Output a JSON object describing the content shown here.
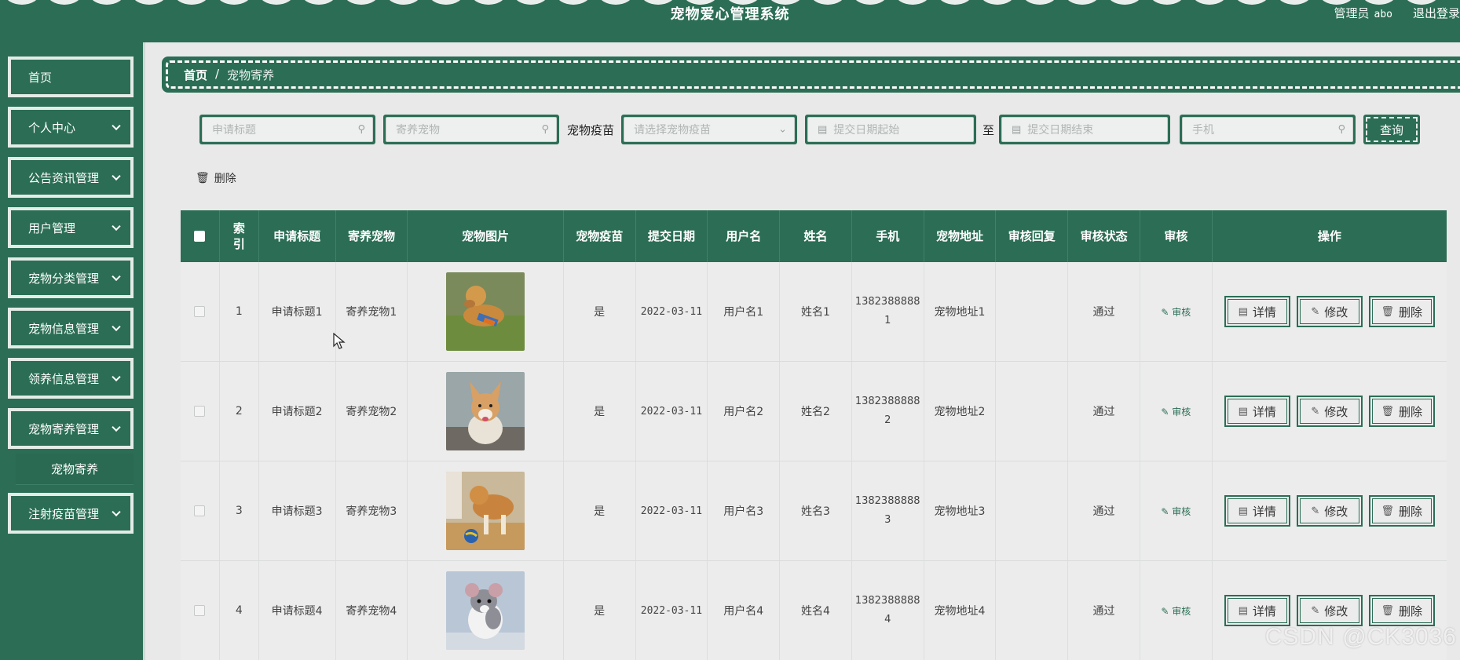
{
  "header": {
    "title": "宠物爱心管理系统",
    "role": "管理员",
    "username": "abo",
    "logout": "退出登录"
  },
  "sidebar": {
    "items": [
      {
        "label": "首页",
        "expandable": false
      },
      {
        "label": "个人中心",
        "expandable": true
      },
      {
        "label": "公告资讯管理",
        "expandable": true
      },
      {
        "label": "用户管理",
        "expandable": true
      },
      {
        "label": "宠物分类管理",
        "expandable": true
      },
      {
        "label": "宠物信息管理",
        "expandable": true
      },
      {
        "label": "领养信息管理",
        "expandable": true
      },
      {
        "label": "宠物寄养管理",
        "expandable": true
      },
      {
        "label": "注射疫苗管理",
        "expandable": true
      }
    ],
    "active_sub": "宠物寄养"
  },
  "breadcrumb": {
    "home": "首页",
    "separator": "/",
    "current": "宠物寄养"
  },
  "search": {
    "title_placeholder": "申请标题",
    "pet_placeholder": "寄养宠物",
    "vaccine_label": "宠物疫苗",
    "vaccine_placeholder": "请选择宠物疫苗",
    "date_start_placeholder": "提交日期起始",
    "to_label": "至",
    "date_end_placeholder": "提交日期结束",
    "phone_placeholder": "手机",
    "query_label": "查询"
  },
  "toolbar": {
    "delete_label": "删除"
  },
  "table": {
    "headers": [
      "",
      "索引",
      "申请标题",
      "寄养宠物",
      "宠物图片",
      "宠物疫苗",
      "提交日期",
      "用户名",
      "姓名",
      "手机",
      "宠物地址",
      "审核回复",
      "审核状态",
      "审核",
      "操作"
    ],
    "audit_label": "审核",
    "op_detail": "详情",
    "op_edit": "修改",
    "op_delete": "删除",
    "rows": [
      {
        "index": "1",
        "title": "申请标题1",
        "pet": "寄养宠物1",
        "image": "dog-running",
        "vaccine": "是",
        "date": "2022-03-11",
        "username": "用户名1",
        "name": "姓名1",
        "phone1": "1382388888",
        "phone2": "1",
        "address": "宠物地址1",
        "reply": "",
        "status": "通过"
      },
      {
        "index": "2",
        "title": "申请标题2",
        "pet": "寄养宠物2",
        "image": "corgi",
        "vaccine": "是",
        "date": "2022-03-11",
        "username": "用户名2",
        "name": "姓名2",
        "phone1": "1382388888",
        "phone2": "2",
        "address": "宠物地址2",
        "reply": "",
        "status": "通过"
      },
      {
        "index": "3",
        "title": "申请标题3",
        "pet": "寄养宠物3",
        "image": "dog-ball",
        "vaccine": "是",
        "date": "2022-03-11",
        "username": "用户名3",
        "name": "姓名3",
        "phone1": "1382388888",
        "phone2": "3",
        "address": "宠物地址3",
        "reply": "",
        "status": "通过"
      },
      {
        "index": "4",
        "title": "申请标题4",
        "pet": "寄养宠物4",
        "image": "rat",
        "vaccine": "是",
        "date": "2022-03-11",
        "username": "用户名4",
        "name": "姓名4",
        "phone1": "1382388888",
        "phone2": "4",
        "address": "宠物地址4",
        "reply": "",
        "status": "通过"
      }
    ]
  },
  "watermark": "CSDN @CK3036",
  "colors": {
    "primary": "#2b6e55",
    "background": "#e9e9e9"
  }
}
